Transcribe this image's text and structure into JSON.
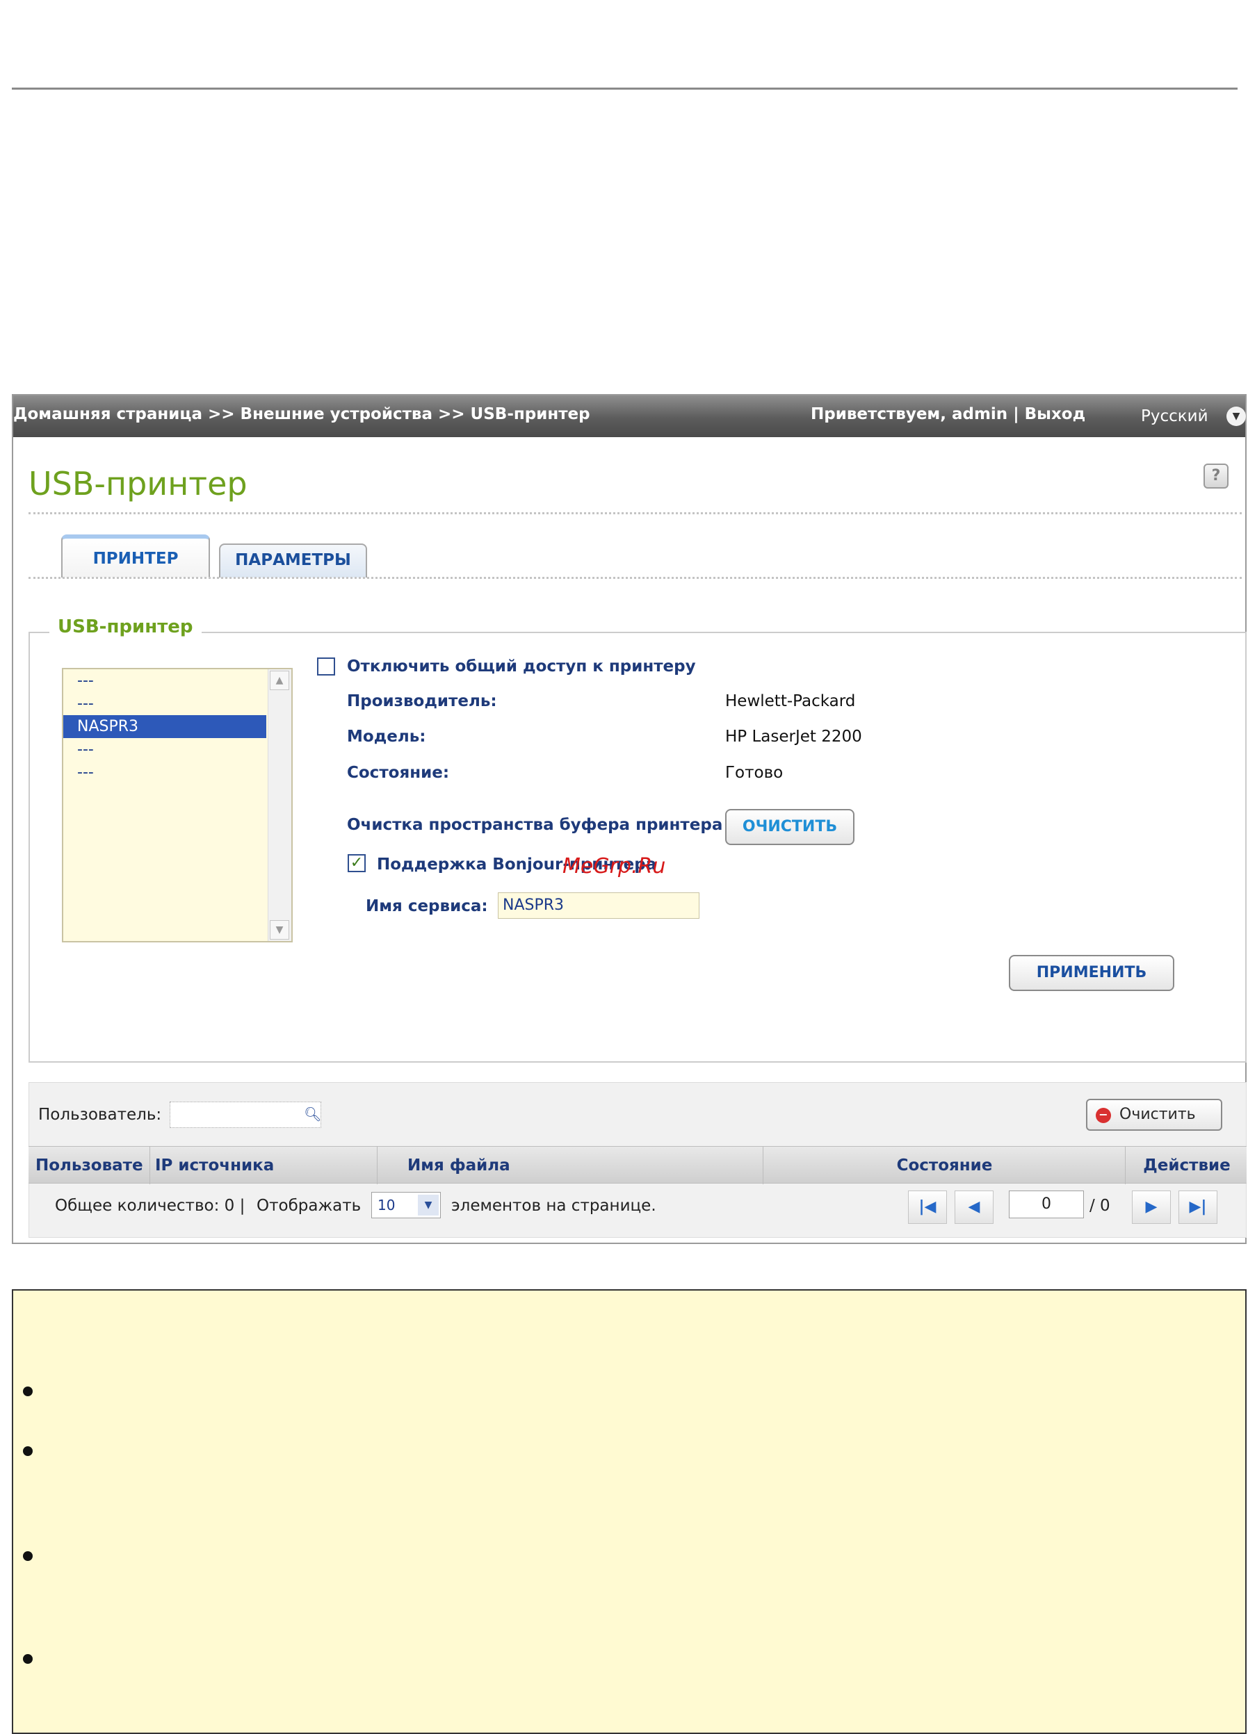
{
  "topbar": {
    "breadcrumb": "Домашняя страница >> Внешние устройства >> USB-принтер",
    "welcome": "Приветствуем, admin",
    "separator": "|",
    "logout": "Выход",
    "language": "Русский"
  },
  "page": {
    "title": "USB-принтер",
    "help_icon": "?"
  },
  "tabs": [
    {
      "label": "ПРИНТЕР",
      "active": true
    },
    {
      "label": "ПАРАМЕТРЫ",
      "active": false
    }
  ],
  "printer_group": {
    "legend": "USB-принтер",
    "list": [
      "---",
      "---",
      "NASPR3",
      "---",
      "---"
    ],
    "selected": "NASPR3",
    "disable_sharing_label": "Отключить общий доступ к принтеру",
    "disable_sharing_checked": false,
    "manufacturer_label": "Производитель:",
    "manufacturer_value": "Hewlett-Packard",
    "model_label": "Модель:",
    "model_value": "HP LaserJet 2200",
    "status_label": "Состояние:",
    "status_value": "Готово",
    "spool_label": "Очистка пространства буфера принтера",
    "spool_button": "ОЧИСТИТЬ",
    "bonjour_label": "Поддержка Bonjour-принтера",
    "bonjour_checked": true,
    "service_name_label": "Имя сервиса:",
    "service_name_value": "NASPR3",
    "apply_button": "ПРИМЕНИТЬ",
    "watermark": "MeGrp.Ru"
  },
  "log": {
    "user_label": "Пользователь:",
    "clear_button": "Очистить",
    "columns": [
      "Пользовате",
      "IP источника",
      "Имя файла",
      "Состояние",
      "Действие"
    ],
    "total_text": "Общее количество: 0 |",
    "show_text": "Отображать",
    "per_page": "10",
    "per_page_suffix": "элементов на странице.",
    "page_value": "0",
    "page_total": "/ 0"
  },
  "colors": {
    "accent_green": "#6ea11e",
    "link_blue": "#1a5fb4",
    "note_background": "#fffad2",
    "selection_blue": "#2d59b9"
  }
}
